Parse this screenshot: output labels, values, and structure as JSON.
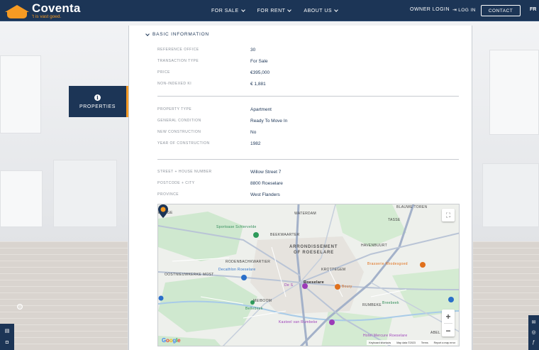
{
  "header": {
    "logo_name": "Coventa",
    "logo_tagline": "'t is vast goed.",
    "nav": [
      {
        "label": "FOR SALE"
      },
      {
        "label": "FOR RENT"
      },
      {
        "label": "ABOUT US"
      }
    ],
    "owner_login": "OWNER LOGIN",
    "log_in": "LOG IN",
    "contact": "CONTACT",
    "language": "FR"
  },
  "side_tab": {
    "label": "PROPERTIES",
    "icon": "info-icon"
  },
  "section": {
    "title": "BASIC INFORMATION"
  },
  "group1": [
    {
      "label": "REFERENCE OFFICE",
      "value": "30"
    },
    {
      "label": "TRANSACTION TYPE",
      "value": "For Sale"
    },
    {
      "label": "PRICE",
      "value": "€395,000"
    },
    {
      "label": "NON-INDEXED KI",
      "value": "€ 1,881"
    }
  ],
  "group2": [
    {
      "label": "PROPERTY TYPE",
      "value": "Apartment"
    },
    {
      "label": "GENERAL CONDITION",
      "value": "Ready To Move In"
    },
    {
      "label": "NEW CONSTRUCTION",
      "value": "No"
    },
    {
      "label": "YEAR OF CONSTRUCTION",
      "value": "1982"
    }
  ],
  "group3": [
    {
      "label": "STREET + HOUSE NUMBER",
      "value": "Willow Street 7"
    },
    {
      "label": "POSTCODE + CITY",
      "value": "8800 Roeselare"
    },
    {
      "label": "PROVINCE",
      "value": "West Flanders"
    }
  ],
  "map": {
    "labels": {
      "eihage": "EIHAGE",
      "waterdam": "WATERDAM",
      "blauwe_toren": "BLAUWE TOREN",
      "sportoase": "Sportoase Schiervelde",
      "tasse": "TASSE",
      "beekwaarter": "BEEKWAARTER",
      "havenbuurt": "HAVENBUURT",
      "arrondissement": "ARRONDISSEMENT",
      "of_roeselare": "OF ROESELARE",
      "rodenbachkwartier": "RODENBACHKWARTIER",
      "brasserie": "Brasserie Rhodesgoed",
      "oostnieuwkerke": "OOSTNIEUWKERKE",
      "most": "MOST",
      "decathlon": "Decathlon Roeselare",
      "krottegem": "KROTTEGEM",
      "roeselare": "Roeselare",
      "de_s": "De S",
      "boury": "Boury",
      "meiboom": "MEIBOOM",
      "beitem": "Bellebeek",
      "rumbeke": "RUMBEKE",
      "breebeek": "Breebeek",
      "kasteel": "Kasteel van Rumbeke",
      "hotel": "Hotel Mercure Roeselare",
      "abele": "ABEL",
      "google": "Google"
    },
    "attribution": [
      "Keyboard shortcuts",
      "Map data ©2023",
      "Terms",
      "Report a map error"
    ],
    "zoom_in": "+",
    "zoom_out": "−"
  },
  "colors": {
    "navy": "#1c3556",
    "accent": "#f59a23"
  }
}
